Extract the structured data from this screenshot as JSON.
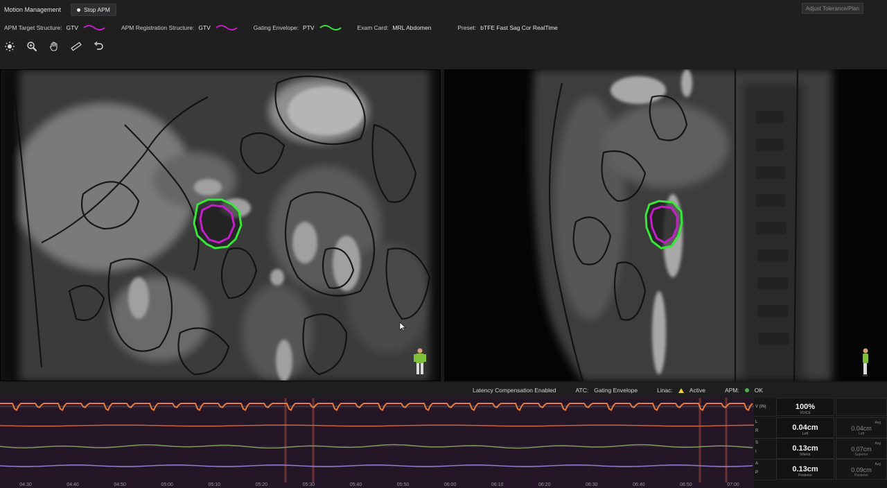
{
  "header": {
    "title": "Motion Management",
    "stop_label": "Stop APM",
    "adjust_label": "Adjust Tolerance/Plan"
  },
  "info": {
    "target_label": "APM Target Structure:",
    "target_value": "GTV",
    "registration_label": "APM Registration Structure:",
    "registration_value": "GTV",
    "envelope_label": "Gating Envelope:",
    "envelope_value": "PTV",
    "exam_label": "Exam Card:",
    "exam_value": "MRL Abdomen",
    "preset_label": "Preset:",
    "preset_value": "bTFE Fast Sag Cor RealTime"
  },
  "tools": [
    {
      "name": "brightness-icon"
    },
    {
      "name": "zoom-icon"
    },
    {
      "name": "pan-hand-icon"
    },
    {
      "name": "ruler-icon"
    },
    {
      "name": "undo-icon"
    }
  ],
  "status": {
    "latency": "Latency Compensation Enabled",
    "atc_label": "ATC:",
    "atc_value": "Gating Envelope",
    "linac_label": "Linac:",
    "linac_value": "Active",
    "apm_label": "APM:",
    "apm_value": "OK"
  },
  "time_axis": [
    "04:30",
    "04:40",
    "04:50",
    "05:00",
    "05:10",
    "05:20",
    "05:30",
    "05:40",
    "05:50",
    "06:00",
    "06:10",
    "06:20",
    "06:30",
    "06:40",
    "06:50",
    "07:00"
  ],
  "metrics": {
    "axis_labels": [
      [
        "V (IN)"
      ],
      [
        "L",
        "R"
      ],
      [
        "S",
        "I"
      ],
      [
        "A",
        "P"
      ]
    ],
    "rows": [
      {
        "value": "100%",
        "caption": "VOICE",
        "side_tiny": "",
        "side_value": "",
        "side_caption": ""
      },
      {
        "value": "0.04cm",
        "caption": "Left",
        "side_tiny": "Avg",
        "side_value": "0.04cm",
        "side_caption": "Left"
      },
      {
        "value": "0.13cm",
        "caption": "Inferior",
        "side_tiny": "Avg",
        "side_value": "0.07cm",
        "side_caption": "Superior"
      },
      {
        "value": "0.13cm",
        "caption": "Posterior",
        "side_tiny": "Avg",
        "side_value": "0.09cm",
        "side_caption": "Posterior"
      }
    ]
  },
  "colors": {
    "target": "#c21fc9",
    "registration": "#c21fc9",
    "envelope": "#39e63a",
    "trace_orange": "#e87a3a",
    "trace_green": "#7d9a5b",
    "trace_purple": "#8e7bd0"
  }
}
